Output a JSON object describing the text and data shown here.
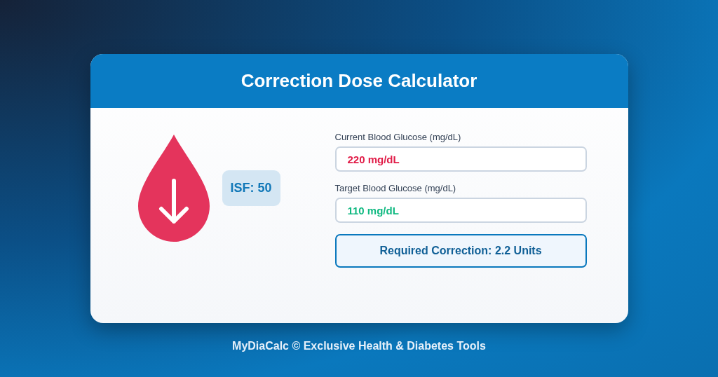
{
  "card": {
    "title": "Correction Dose Calculator"
  },
  "isf_badge": "ISF: 50",
  "fields": [
    {
      "label": "Current Blood Glucose (mg/dL)",
      "value": "220 mg/dL",
      "color": "#e11d48"
    },
    {
      "label": "Target Blood Glucose (mg/dL)",
      "value": "110 mg/dL",
      "color": "#10b981"
    }
  ],
  "result": "Required Correction: 2.2 Units",
  "footer": "MyDiaCalc © Exclusive Health & Diabetes Tools"
}
